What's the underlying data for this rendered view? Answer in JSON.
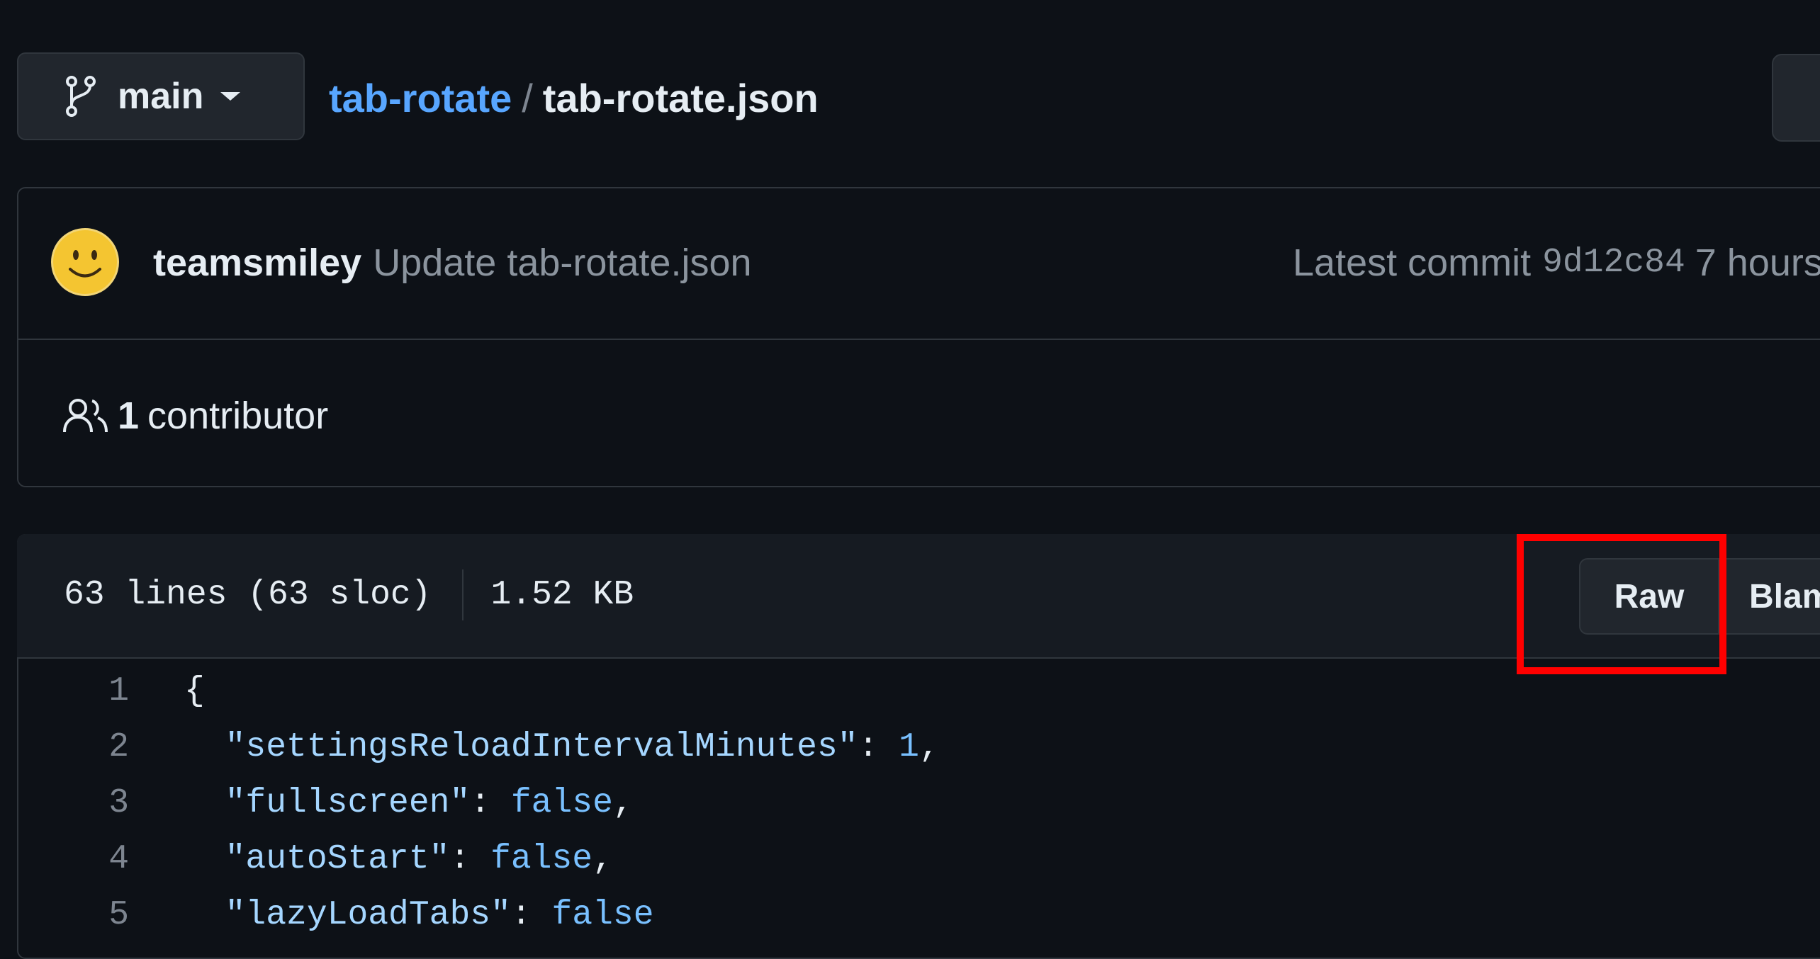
{
  "branch": {
    "label": "main"
  },
  "breadcrumb": {
    "repo": "tab-rotate",
    "separator": "/",
    "file": "tab-rotate.json"
  },
  "commit": {
    "author": "teamsmiley",
    "message": "Update tab-rotate.json",
    "latest_label": "Latest commit",
    "sha": "9d12c84",
    "age": "7 hours"
  },
  "contributors": {
    "count": "1",
    "label": "contributor"
  },
  "file": {
    "lines_info": "63 lines (63 sloc)",
    "size": "1.52 KB",
    "raw_label": "Raw",
    "blame_label": "Blam"
  },
  "code": [
    {
      "n": "1",
      "tokens": [
        {
          "t": "{",
          "c": "tok-p"
        }
      ]
    },
    {
      "n": "2",
      "tokens": [
        {
          "t": "  \"settingsReloadIntervalMinutes\"",
          "c": "tok-str"
        },
        {
          "t": ": ",
          "c": "tok-p"
        },
        {
          "t": "1",
          "c": "tok-num"
        },
        {
          "t": ",",
          "c": "tok-p"
        }
      ]
    },
    {
      "n": "3",
      "tokens": [
        {
          "t": "  \"fullscreen\"",
          "c": "tok-str"
        },
        {
          "t": ": ",
          "c": "tok-p"
        },
        {
          "t": "false",
          "c": "tok-bool"
        },
        {
          "t": ",",
          "c": "tok-p"
        }
      ]
    },
    {
      "n": "4",
      "tokens": [
        {
          "t": "  \"autoStart\"",
          "c": "tok-str"
        },
        {
          "t": ": ",
          "c": "tok-p"
        },
        {
          "t": "false",
          "c": "tok-bool"
        },
        {
          "t": ",",
          "c": "tok-p"
        }
      ]
    },
    {
      "n": "5",
      "tokens": [
        {
          "t": "  \"lazyLoadTabs\"",
          "c": "tok-str"
        },
        {
          "t": ": ",
          "c": "tok-p"
        },
        {
          "t": "false",
          "c": "tok-bool"
        }
      ]
    }
  ],
  "colors": {
    "accent_link": "#58a6ff",
    "highlight": "#ff0000",
    "background": "#0d1117"
  },
  "icons": {
    "branch": "git-branch-icon",
    "caret": "caret-down-icon",
    "people": "people-icon",
    "avatar": "smiley-avatar"
  }
}
